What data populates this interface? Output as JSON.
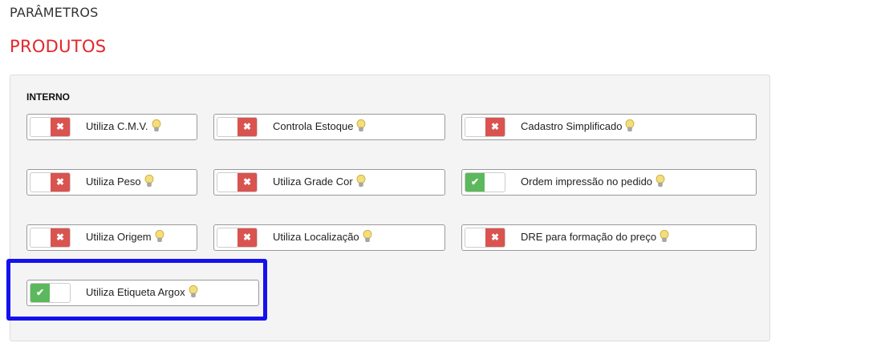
{
  "page": {
    "heading": "PARÂMETROS",
    "section_title": "PRODUTOS"
  },
  "panel": {
    "group_label": "INTERNO",
    "options": [
      {
        "label": "Utiliza C.M.V.",
        "enabled": false
      },
      {
        "label": "Controla Estoque",
        "enabled": false
      },
      {
        "label": "Cadastro Simplificado",
        "enabled": false
      },
      {
        "label": "Utiliza Peso",
        "enabled": false
      },
      {
        "label": "Utiliza Grade Cor",
        "enabled": false
      },
      {
        "label": "Ordem impressão no pedido",
        "enabled": true
      },
      {
        "label": "Utiliza Origem",
        "enabled": false
      },
      {
        "label": "Utiliza Localização",
        "enabled": false
      },
      {
        "label": "DRE para formação do preço",
        "enabled": false
      },
      {
        "label": "Utiliza Etiqueta Argox",
        "enabled": true
      }
    ]
  },
  "colors": {
    "section_title": "#e3262b",
    "toggle_on": "#5cb85c",
    "toggle_off": "#d9534f",
    "highlight_border": "#1411ee"
  },
  "icons": {
    "on": "check-icon",
    "off": "x-icon",
    "hint": "lightbulb-icon"
  }
}
